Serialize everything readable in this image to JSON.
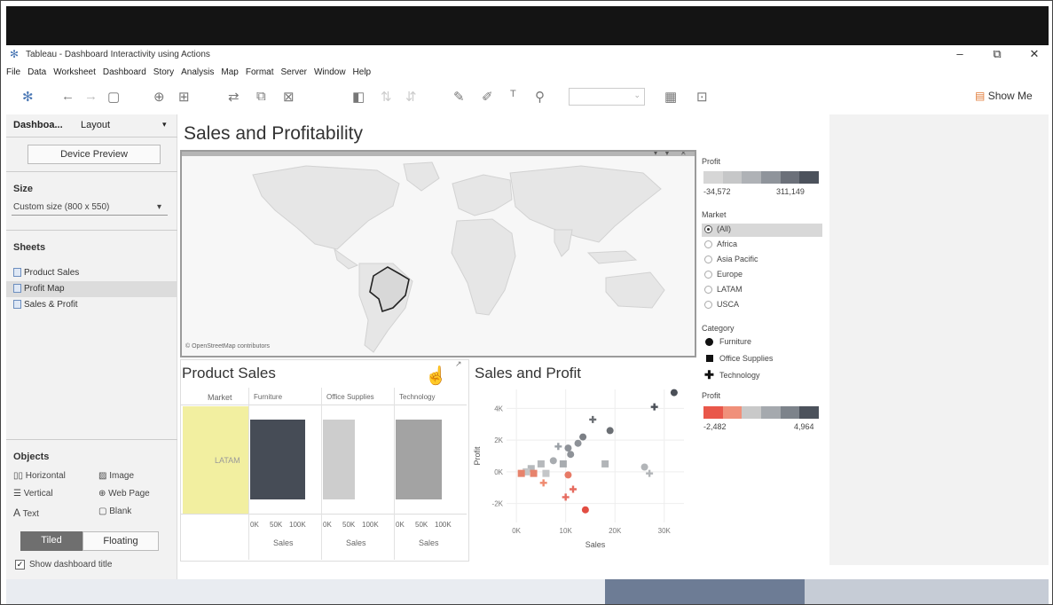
{
  "window": {
    "title": "Tableau - Dashboard Interactivity using Actions",
    "minimize": "–",
    "restore": "⧉",
    "close": "✕"
  },
  "menu": [
    "File",
    "Data",
    "Worksheet",
    "Dashboard",
    "Story",
    "Analysis",
    "Map",
    "Format",
    "Server",
    "Window",
    "Help"
  ],
  "toolbar": {
    "show_me": "Show Me"
  },
  "left_panel": {
    "tab_dashboard": "Dashboa...",
    "tab_layout": "Layout",
    "device_preview": "Device Preview",
    "size_heading": "Size",
    "size_value": "Custom size (800 x 550)",
    "sheets_heading": "Sheets",
    "sheets": [
      "Product Sales",
      "Profit Map",
      "Sales & Profit"
    ],
    "objects_heading": "Objects",
    "objects": [
      "Horizontal",
      "Image",
      "Vertical",
      "Web Page",
      "Text",
      "Blank"
    ],
    "tiled": "Tiled",
    "floating": "Floating",
    "show_title": "Show dashboard title"
  },
  "dashboard": {
    "title": "Sales and Profitability",
    "map_attribution": "© OpenStreetMap contributors",
    "profit_legend": {
      "title": "Profit",
      "min": "-34,572",
      "max": "311,149"
    },
    "market_legend": {
      "title": "Market",
      "options": [
        "(All)",
        "Africa",
        "Asia Pacific",
        "Europe",
        "LATAM",
        "USCA"
      ]
    },
    "category_legend": {
      "title": "Category",
      "items": [
        "Furniture",
        "Office Supplies",
        "Technology"
      ]
    },
    "profit_legend2": {
      "title": "Profit",
      "min": "-2,482",
      "max": "4,964"
    }
  },
  "chart_data": [
    {
      "type": "bar",
      "title": "Product Sales",
      "row_header": "Market",
      "row": "LATAM",
      "categories": [
        "Furniture",
        "Office Supplies",
        "Technology"
      ],
      "values": [
        95000,
        55000,
        80000
      ],
      "colors": [
        "#464c56",
        "#cdcdcd",
        "#a3a3a3"
      ],
      "ticks": [
        "0K",
        "50K",
        "100K"
      ],
      "xlabel": "Sales"
    },
    {
      "type": "scatter",
      "title": "Sales and Profit",
      "xlabel": "Sales",
      "ylabel": "Profit",
      "xticks": [
        "0K",
        "10K",
        "20K",
        "30K"
      ],
      "yticks": [
        "4K",
        "2K",
        "0K",
        "-2K"
      ],
      "xlim": [
        -2000,
        34000
      ],
      "ylim": [
        -3200,
        5200
      ],
      "points": [
        {
          "x": 32000,
          "y": 5000,
          "shape": "circle",
          "color": "#4a4f57"
        },
        {
          "x": 28000,
          "y": 4100,
          "shape": "plus",
          "color": "#4a4f57"
        },
        {
          "x": 15500,
          "y": 3300,
          "shape": "plus",
          "color": "#6b6f74"
        },
        {
          "x": 19000,
          "y": 2600,
          "shape": "circle",
          "color": "#6b6f74"
        },
        {
          "x": 13500,
          "y": 2200,
          "shape": "circle",
          "color": "#7b7f85"
        },
        {
          "x": 12500,
          "y": 1800,
          "shape": "circle",
          "color": "#8e9298"
        },
        {
          "x": 10500,
          "y": 1500,
          "shape": "circle",
          "color": "#8e9298"
        },
        {
          "x": 8500,
          "y": 1600,
          "shape": "plus",
          "color": "#9aa0a6"
        },
        {
          "x": 11000,
          "y": 1100,
          "shape": "circle",
          "color": "#8e9298"
        },
        {
          "x": 7500,
          "y": 700,
          "shape": "circle",
          "color": "#a8acb0"
        },
        {
          "x": 9500,
          "y": 500,
          "shape": "square",
          "color": "#a8acb0"
        },
        {
          "x": 18000,
          "y": 500,
          "shape": "square",
          "color": "#b2b5b8"
        },
        {
          "x": 26000,
          "y": 300,
          "shape": "circle",
          "color": "#b2b5b8"
        },
        {
          "x": 27000,
          "y": -100,
          "shape": "plus",
          "color": "#b2b5b8"
        },
        {
          "x": 5000,
          "y": 500,
          "shape": "square",
          "color": "#b6b9bc"
        },
        {
          "x": 3000,
          "y": 200,
          "shape": "square",
          "color": "#b6b9bc"
        },
        {
          "x": 2000,
          "y": 0,
          "shape": "square",
          "color": "#c4c6c8"
        },
        {
          "x": 1000,
          "y": -100,
          "shape": "square",
          "color": "#e7836c"
        },
        {
          "x": 3500,
          "y": -100,
          "shape": "square",
          "color": "#e7836c"
        },
        {
          "x": 6000,
          "y": -100,
          "shape": "square",
          "color": "#c4c6c8"
        },
        {
          "x": 10500,
          "y": -200,
          "shape": "circle",
          "color": "#e77a66"
        },
        {
          "x": 5500,
          "y": -700,
          "shape": "plus",
          "color": "#ef8a6f"
        },
        {
          "x": 11500,
          "y": -1100,
          "shape": "plus",
          "color": "#e66b5f"
        },
        {
          "x": 10000,
          "y": -1600,
          "shape": "plus",
          "color": "#e66b5f"
        },
        {
          "x": 14000,
          "y": -2400,
          "shape": "circle",
          "color": "#e24d42"
        }
      ]
    }
  ]
}
